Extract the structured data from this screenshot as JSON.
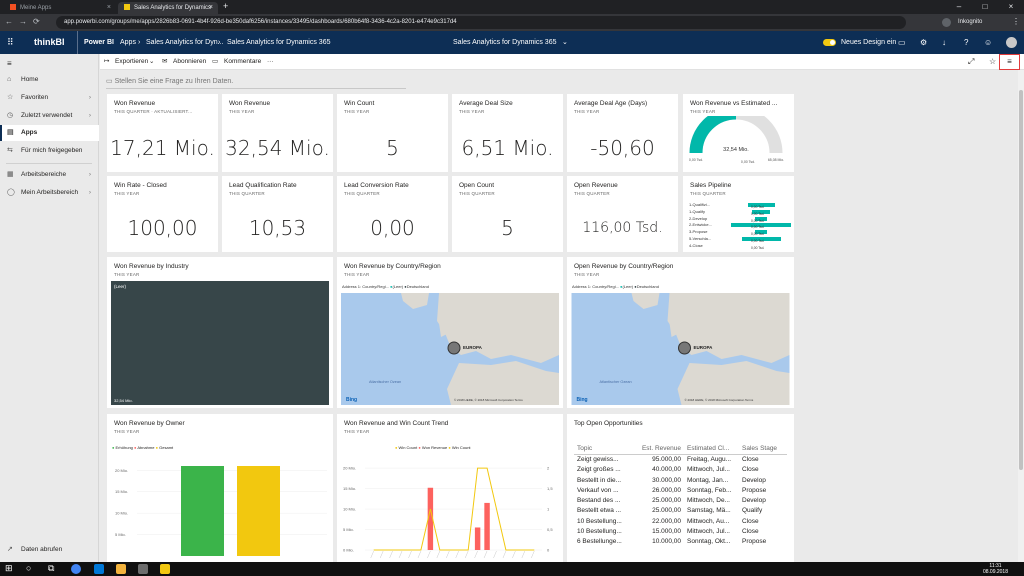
{
  "browser": {
    "tabs": [
      {
        "label": "Meine Apps",
        "active": false
      },
      {
        "label": "Sales Analytics for Dynamics 365",
        "active": true
      }
    ],
    "new_tab": "+",
    "url": "app.powerbi.com/groups/me/apps/2826b83-0691-4b4f-926d-be350daf6256/instances/33495/dashboards/680b64f8-3436-4c2a-8201-e474e9c317d4",
    "profile_label": "Inkognito"
  },
  "header": {
    "brand": "thinkBI",
    "product": "Power BI",
    "breadcrumb": [
      "Apps",
      "Sales Analytics for Dyn...",
      "Sales Analytics for Dynamics 365"
    ],
    "center_title": "Sales Analytics for Dynamics 365",
    "toggle_label": "Neues Design ein"
  },
  "nav": {
    "items": [
      {
        "label": "Home",
        "icon": "home-icon"
      },
      {
        "label": "Favoriten",
        "icon": "star-icon",
        "chevron": true
      },
      {
        "label": "Zuletzt verwendet",
        "icon": "clock-icon",
        "chevron": true
      },
      {
        "label": "Apps",
        "icon": "apps-icon",
        "active": true
      },
      {
        "label": "Für mich freigegeben",
        "icon": "share-icon"
      },
      {
        "label": "Arbeitsbereiche",
        "icon": "workspace-icon",
        "chevron": true
      },
      {
        "label": "Mein Arbeitsbereich",
        "icon": "person-icon",
        "chevron": true
      }
    ],
    "footer": "Daten abrufen"
  },
  "actions": {
    "export": "Exportieren",
    "subscribe": "Abonnieren",
    "comments": "Kommentare",
    "more": "···"
  },
  "qa_placeholder": "Stellen Sie eine Frage zu Ihren Daten.",
  "kpis": [
    {
      "title": "Won Revenue",
      "sub": "THIS QUARTER · AKTUALISIERT...",
      "value": "17,21 Mio."
    },
    {
      "title": "Won Revenue",
      "sub": "THIS YEAR",
      "value": "32,54 Mio."
    },
    {
      "title": "Win Count",
      "sub": "THIS YEAR",
      "value": "5"
    },
    {
      "title": "Average Deal Size",
      "sub": "THIS YEAR",
      "value": "6,51 Mio."
    },
    {
      "title": "Average Deal Age (Days)",
      "sub": "THIS YEAR",
      "value": "-50,60"
    },
    {
      "title": "Win Rate - Closed",
      "sub": "THIS YEAR",
      "value": "100,00"
    },
    {
      "title": "Lead Qualification Rate",
      "sub": "THIS QUARTER",
      "value": "10,53"
    },
    {
      "title": "Lead Conversion Rate",
      "sub": "THIS QUARTER",
      "value": "0,00"
    },
    {
      "title": "Open Count",
      "sub": "THIS QUARTER",
      "value": "5"
    },
    {
      "title": "Open Revenue",
      "sub": "THIS QUARTER",
      "value": "116,00 Tsd."
    }
  ],
  "gauge": {
    "title": "Won Revenue vs Estimated ...",
    "sub": "THIS YEAR",
    "value_label": "32,54 Mio.",
    "min_label": "0,00 Tsd.",
    "max_label": "65,08 Mio.",
    "target_label": "0,00 Tsd.",
    "value_fraction": 0.5,
    "color": "#01b8aa"
  },
  "pipeline": {
    "title": "Sales Pipeline",
    "sub": "THIS QUARTER",
    "color": "#01b8aa",
    "stages": [
      {
        "label": "1-Qualifizi...",
        "value_label": "0,00 Tsd.",
        "value": 0.45
      },
      {
        "label": "1-Qualify",
        "value_label": "0,00 Tsd.",
        "value": 0.3
      },
      {
        "label": "2-Develop",
        "value_label": "0,00 Tsd.",
        "value": 0.2
      },
      {
        "label": "2-Entwicke...",
        "value_label": "0,00 Tsd.",
        "value": 1.0
      },
      {
        "label": "3-Propose",
        "value_label": "0,00 Tsd.",
        "value": 0.2
      },
      {
        "label": "5-Verschla...",
        "value_label": "0,00 Tsd.",
        "value": 0.65
      },
      {
        "label": "4-Close",
        "value_label": "0,00 Tsd.",
        "value": 0.0
      }
    ]
  },
  "industry": {
    "title": "Won Revenue by Industry",
    "sub": "THIS YEAR",
    "inner_label": "(Leer)",
    "value_label": "32,54 Mio."
  },
  "maps": [
    {
      "title": "Won Revenue by Country/Region",
      "sub": "THIS YEAR",
      "legend_prefix": "Address 1: Country/Regi...",
      "legend_items": [
        "(Leer)",
        "Deutschland"
      ],
      "point_label": "EUROPA",
      "ocean_label": "Atlantischer Ozean",
      "attribution": "© 2018 HERE, © 2018 Microsoft Corporation Terms",
      "bing": "Bing"
    },
    {
      "title": "Open Revenue by Country/Region",
      "sub": "THIS YEAR",
      "legend_prefix": "Address 1: Country/Regi...",
      "legend_items": [
        "(Leer)",
        "Deutschland"
      ],
      "point_label": "EUROPA",
      "ocean_label": "Atlantischer Ozean",
      "attribution": "© 2018 HERE, © 2018 Microsoft Corporation Terms",
      "bing": "Bing"
    }
  ],
  "owner": {
    "title": "Won Revenue by Owner",
    "sub": "THIS YEAR",
    "chart_data": {
      "type": "bar",
      "series": [
        {
          "name": "Erhöhung",
          "color": "#3bb44a",
          "values": [
            21.0
          ]
        },
        {
          "name": "Abnahme",
          "color": "#fd625e",
          "values": [
            0
          ]
        },
        {
          "name": "Gesamt",
          "color": "#f2c80f",
          "values": [
            21.0
          ]
        }
      ],
      "yticks": [
        "20 Mio.",
        "15 Mio.",
        "10 Mio.",
        "5 Mio."
      ],
      "ylim": [
        0,
        21
      ]
    }
  },
  "trend": {
    "title": "Won Revenue and Win Count Trend",
    "sub": "THIS YEAR",
    "chart_data": {
      "type": "bar",
      "legend": [
        "Win Count",
        "Won Revenue",
        "Win Count"
      ],
      "legend_colors": [
        "#f2c80f",
        "#fd625e",
        "#f2c80f"
      ],
      "yticks_left": [
        "20 Mio.",
        "15 Mio.",
        "10 Mio.",
        "5 Mio.",
        "0 Mio."
      ],
      "yticks_right": [
        "2",
        "1,5",
        "1",
        "0,5",
        "0"
      ],
      "ylim": [
        0,
        21
      ],
      "bars": [
        0,
        0,
        0,
        0,
        0,
        0,
        15.2,
        0,
        0,
        0,
        0,
        5.5,
        11.5,
        0,
        0,
        0,
        0,
        0
      ],
      "line": [
        0,
        0,
        0,
        0,
        0,
        0,
        1,
        0,
        0,
        0,
        0,
        2,
        2,
        1,
        0,
        0,
        0,
        0
      ]
    }
  },
  "opportunities": {
    "title": "Top Open Opportunities",
    "columns": [
      "Topic",
      "Est. Revenue",
      "Estimated Cl...",
      "Sales Stage"
    ],
    "rows": [
      [
        "Zeigt gewiss...",
        "95.000,00",
        "Freitag, Augu...",
        "Close"
      ],
      [
        "Zeigt großes ...",
        "40.000,00",
        "Mittwoch, Jul...",
        "Close"
      ],
      [
        "Bestellt in die...",
        "30.000,00",
        "Montag, Jan...",
        "Develop"
      ],
      [
        "Verkauf von ...",
        "26.000,00",
        "Sonntag, Feb...",
        "Propose"
      ],
      [
        "Bestand des ...",
        "25.000,00",
        "Mittwoch, De...",
        "Develop"
      ],
      [
        "Bestellt etwa ...",
        "25.000,00",
        "Samstag, Mä...",
        "Qualify"
      ],
      [
        "10 Bestellung...",
        "22.000,00",
        "Mittwoch, Au...",
        "Close"
      ],
      [
        "10 Bestellung...",
        "15.000,00",
        "Mittwoch, Jul...",
        "Close"
      ],
      [
        "6 Bestellunge...",
        "10.000,00",
        "Sonntag, Okt...",
        "Propose"
      ]
    ]
  },
  "taskbar": {
    "time": "11:31",
    "date": "08.09.2018"
  }
}
